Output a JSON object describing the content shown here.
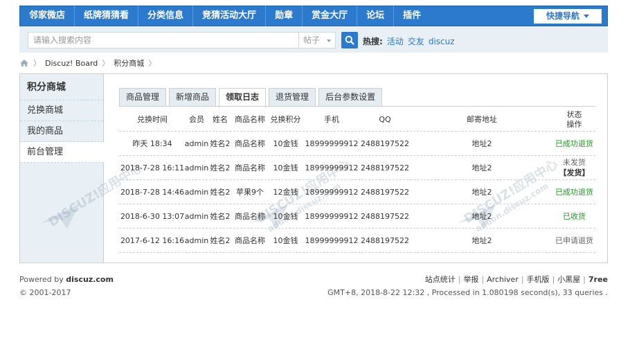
{
  "nav": {
    "items": [
      "邻家微店",
      "纸牌猜猜看",
      "分类信息",
      "竞猜活动大厅",
      "勋章",
      "赏金大厅",
      "论坛",
      "插件"
    ],
    "quick_nav": "快捷导航"
  },
  "search": {
    "placeholder": "请输入搜索内容",
    "type": "帖子",
    "hot_label": "热搜:",
    "hot_links": [
      "活动",
      "交友",
      "discuz"
    ]
  },
  "breadcrumb": [
    "Discuz! Board",
    "积分商城"
  ],
  "sidebar": {
    "title": "积分商城",
    "items": [
      "兑换商城",
      "我的商品",
      "前台管理"
    ]
  },
  "tabs": [
    "商品管理",
    "新增商品",
    "领取日志",
    "退货管理",
    "后台参数设置"
  ],
  "table": {
    "headers": [
      "兑换时间",
      "会员",
      "姓名",
      "商品名称",
      "兑换积分",
      "手机",
      "QQ",
      "邮寄地址",
      "状态",
      "操作"
    ],
    "rows": [
      {
        "time": "昨天 18:34",
        "user": "admin",
        "name": "姓名2",
        "product": "商品名称",
        "points": "10金钱",
        "phone": "18999999912",
        "qq": "2488197522",
        "address": "地址2",
        "status": "已成功退货",
        "action": ""
      },
      {
        "time": "2018-7-28 16:11",
        "user": "admin",
        "name": "姓名2",
        "product": "商品名称",
        "points": "10金钱",
        "phone": "18999999912",
        "qq": "2488197522",
        "address": "地址2",
        "status": "未发货",
        "action": "【发货】"
      },
      {
        "time": "2018-7-28 14:46",
        "user": "admin",
        "name": "姓名2",
        "product": "苹果9个",
        "points": "12金钱",
        "phone": "18999999912",
        "qq": "2488197522",
        "address": "地址2",
        "status": "已成功退货",
        "action": ""
      },
      {
        "time": "2018-6-30 13:07",
        "user": "admin",
        "name": "姓名2",
        "product": "商品名称",
        "points": "10金钱",
        "phone": "18999999912",
        "qq": "2488197522",
        "address": "地址2",
        "status": "已收货",
        "action": ""
      },
      {
        "time": "2017-6-12 16:16",
        "user": "admin",
        "name": "姓名2",
        "product": "商品名称",
        "points": "10金钱",
        "phone": "18999999912",
        "qq": "2488197522",
        "address": "地址2",
        "status": "已申请退货",
        "action": ""
      }
    ]
  },
  "watermark": {
    "text": "DISCUZ!应用中心",
    "subtext": "addon.discuz.com"
  },
  "footer": {
    "powered_prefix": "Powered by ",
    "powered_brand": "discuz.com",
    "copyright": "© 2001-2017",
    "links": [
      "站点统计",
      "举报",
      "Archiver",
      "手机版",
      "小黑屋"
    ],
    "brand_right": "7ree",
    "stats": "GMT+8, 2018-8-22 12:32 , Processed in 1.080198 second(s), 33 queries ."
  },
  "colors": {
    "nav_bg": "#2b7acd",
    "status_green": "#1a9e1a"
  }
}
